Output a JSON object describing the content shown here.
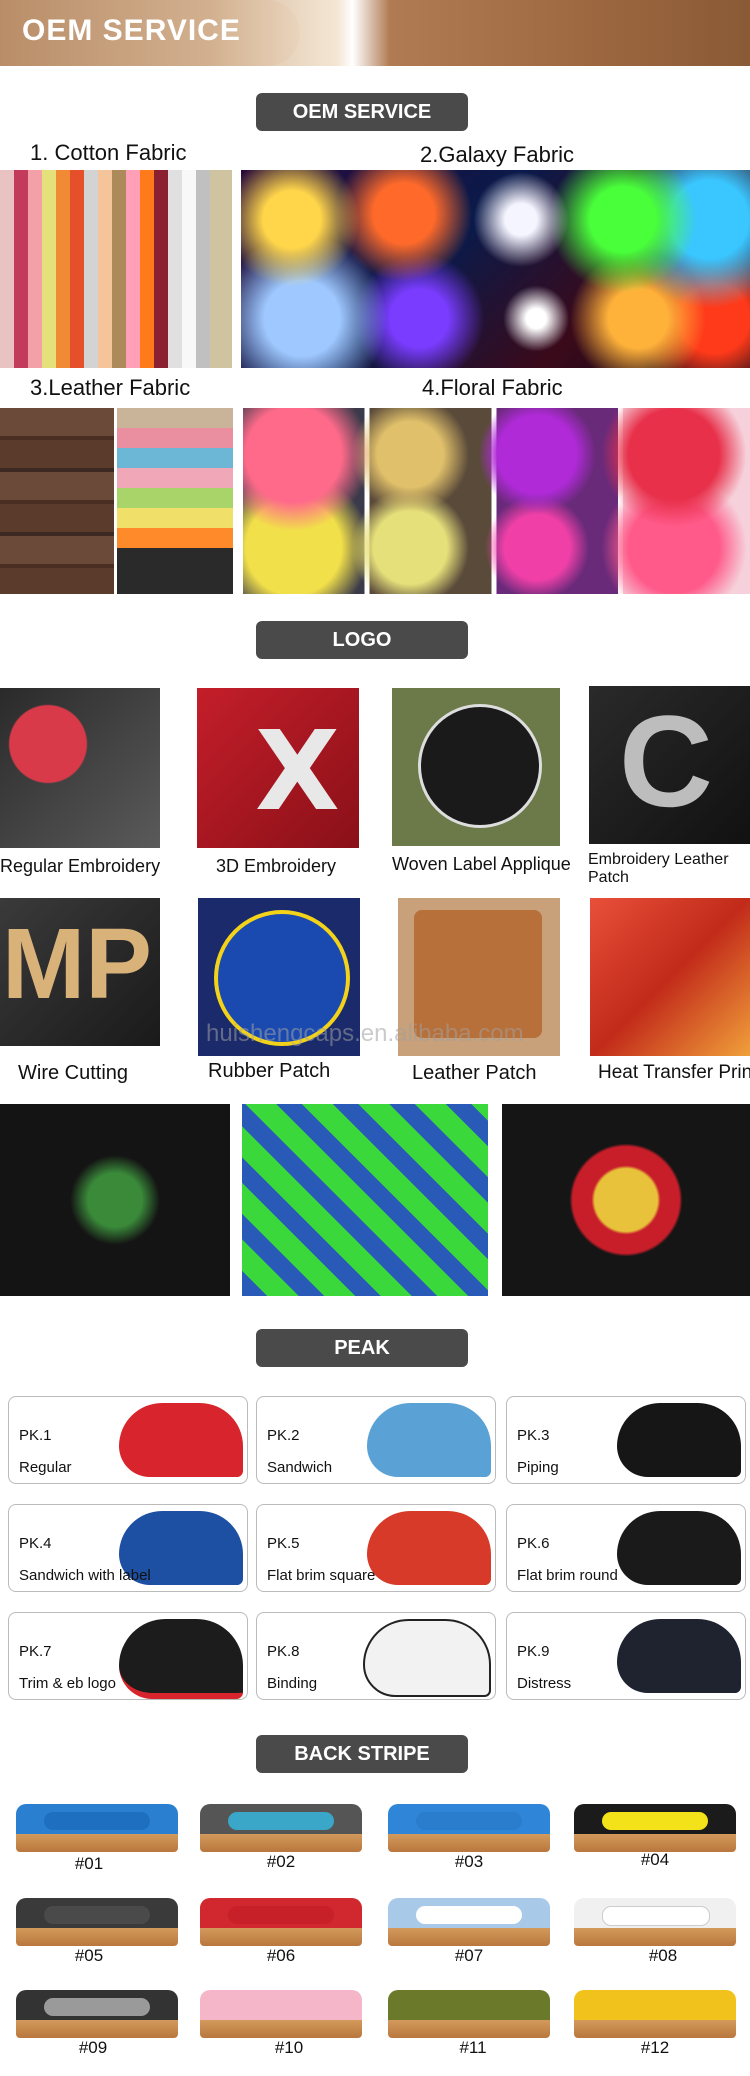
{
  "header": {
    "title": "OEM SERVICE"
  },
  "sections": {
    "oem": "OEM SERVICE",
    "logo": "LOGO",
    "peak": "PEAK",
    "back_stripe": "BACK STRIPE"
  },
  "fabrics": [
    {
      "label": "1. Cotton Fabric"
    },
    {
      "label": "2.Galaxy Fabric"
    },
    {
      "label": "3.Leather Fabric"
    },
    {
      "label": "4.Floral Fabric"
    }
  ],
  "logos": [
    {
      "label": "Regular Embroidery"
    },
    {
      "label": "3D Embroidery"
    },
    {
      "label": "Woven Label Applique"
    },
    {
      "label": "Embroidery Leather Patch"
    },
    {
      "label": "Wire Cutting"
    },
    {
      "label": "Rubber Patch"
    },
    {
      "label": "Leather Patch"
    },
    {
      "label": "Heat Transfer Printing"
    }
  ],
  "watermark": "huishengcaps.en.alibaba.com",
  "peaks": [
    {
      "code": "PK.1",
      "name": "Regular",
      "color": "#d8242c"
    },
    {
      "code": "PK.2",
      "name": "Sandwich",
      "color": "#5aa2d6"
    },
    {
      "code": "PK.3",
      "name": "Piping",
      "color": "#161616"
    },
    {
      "code": "PK.4",
      "name": "Sandwich with label",
      "color": "#1d4fa3"
    },
    {
      "code": "PK.5",
      "name": "Flat  brim square",
      "color": "#d83a2a"
    },
    {
      "code": "PK.6",
      "name": "Flat brim round",
      "color": "#1a1a1a"
    },
    {
      "code": "PK.7",
      "name": "Trim & eb logo",
      "color": "#1c1c1c"
    },
    {
      "code": "PK.8",
      "name": "Binding",
      "color": "#f2f2f2"
    },
    {
      "code": "PK.9",
      "name": "Distress",
      "color": "#1f2330"
    }
  ],
  "stripes": [
    {
      "num": "#01",
      "cap": "#2a7fd0",
      "band": "#1e6fc0"
    },
    {
      "num": "#02",
      "cap": "#555555",
      "band": "#3aa6c8"
    },
    {
      "num": "#03",
      "cap": "#2f86d8",
      "band": "#2a7ccc"
    },
    {
      "num": "#04",
      "cap": "#1b1b1b",
      "band": "#f3e21a"
    },
    {
      "num": "#05",
      "cap": "#3a3a3a",
      "band": "#4a4a4a"
    },
    {
      "num": "#06",
      "cap": "#d0282e",
      "band": "#c82028"
    },
    {
      "num": "#07",
      "cap": "#a9c9e9",
      "band": "#ffffff"
    },
    {
      "num": "#08",
      "cap": "#f0f0f0",
      "band": "#ffffff"
    },
    {
      "num": "#09",
      "cap": "#333333",
      "band": "#9a9a9a"
    },
    {
      "num": "#10",
      "cap": "#f4b6c8",
      "band": "#f4b6c8"
    },
    {
      "num": "#11",
      "cap": "#6b7a2a",
      "band": "#6b7a2a"
    },
    {
      "num": "#12",
      "cap": "#f1c21b",
      "band": "#f1c21b"
    }
  ]
}
